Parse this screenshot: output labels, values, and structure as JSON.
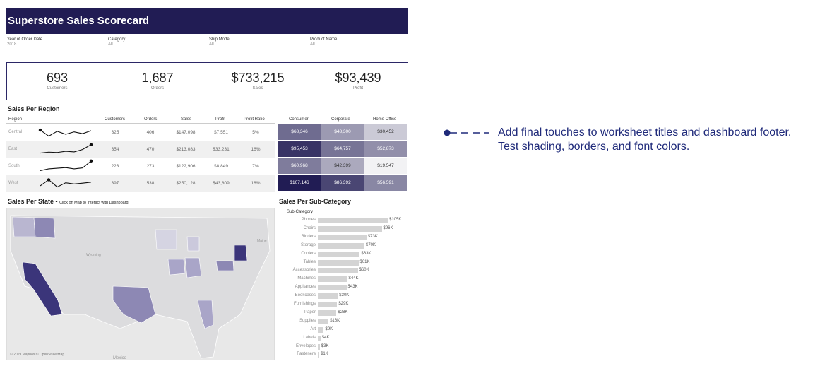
{
  "dashboard": {
    "title": "Superstore Sales Scorecard",
    "filters": [
      {
        "label": "Year of Order Date",
        "value": "2018"
      },
      {
        "label": "Category",
        "value": "All"
      },
      {
        "label": "Ship Mode",
        "value": "All"
      },
      {
        "label": "Product Name",
        "value": "All"
      }
    ],
    "kpis": [
      {
        "value": "693",
        "label": "Customers"
      },
      {
        "value": "1,687",
        "label": "Orders"
      },
      {
        "value": "$733,215",
        "label": "Sales"
      },
      {
        "value": "$93,439",
        "label": "Profit"
      }
    ],
    "region_section": {
      "title": "Sales Per Region",
      "region_header": "Region",
      "columns": [
        "Customers",
        "Orders",
        "Sales",
        "Profit",
        "Profit Ratio"
      ],
      "segment_columns": [
        "Consumer",
        "Corporate",
        "Home Office"
      ],
      "rows": [
        {
          "region": "Central",
          "customers": "325",
          "orders": "406",
          "sales": "$147,098",
          "profit": "$7,551",
          "ratio": "5%",
          "segments": [
            "$68,346",
            "$48,300",
            "$30,452"
          ],
          "segment_values": [
            68346,
            48300,
            30452
          ],
          "sparkline": [
            70,
            20,
            60,
            35,
            55,
            40,
            65
          ]
        },
        {
          "region": "East",
          "customers": "354",
          "orders": "470",
          "sales": "$213,083",
          "profit": "$33,231",
          "ratio": "16%",
          "segments": [
            "$95,453",
            "$64,757",
            "$52,873"
          ],
          "segment_values": [
            95453,
            64757,
            52873
          ],
          "sparkline": [
            20,
            28,
            25,
            35,
            30,
            50,
            90
          ]
        },
        {
          "region": "South",
          "customers": "223",
          "orders": "273",
          "sales": "$122,906",
          "profit": "$8,849",
          "ratio": "7%",
          "segments": [
            "$60,968",
            "$42,399",
            "$19,547"
          ],
          "segment_values": [
            60968,
            42399,
            19547
          ],
          "sparkline": [
            15,
            30,
            35,
            40,
            30,
            38,
            95
          ]
        },
        {
          "region": "West",
          "customers": "397",
          "orders": "538",
          "sales": "$250,128",
          "profit": "$43,809",
          "ratio": "18%",
          "segments": [
            "$107,146",
            "$86,392",
            "$56,591"
          ],
          "segment_values": [
            107146,
            86392,
            56591
          ],
          "sparkline": [
            30,
            80,
            20,
            55,
            45,
            52,
            60
          ]
        }
      ],
      "heat_colors": {
        "low": "#f2f2f4",
        "high": "#211c54"
      }
    },
    "state_section": {
      "title": "Sales Per State -",
      "subtitle": "Click on Map to Interact with Dashboard",
      "map_labels": [
        "Wyoming",
        "Maine",
        "Mexico"
      ],
      "attribution": "© 2019 Mapbox © OpenStreetMap"
    },
    "subcategory_section": {
      "title": "Sales Per Sub-Category",
      "axis_header": "Sub-Category"
    }
  },
  "chart_data": {
    "type": "bar",
    "title": "Sales Per Sub-Category",
    "categories": [
      "Phones",
      "Chairs",
      "Binders",
      "Storage",
      "Copiers",
      "Tables",
      "Accessories",
      "Machines",
      "Appliances",
      "Bookcases",
      "Furnishings",
      "Paper",
      "Supplies",
      "Art",
      "Labels",
      "Envelopes",
      "Fasteners"
    ],
    "values": [
      105,
      96,
      73,
      70,
      63,
      61,
      60,
      44,
      43,
      30,
      29,
      28,
      16,
      9,
      4,
      3,
      1
    ],
    "value_labels": [
      "$105K",
      "$96K",
      "$73K",
      "$70K",
      "$63K",
      "$61K",
      "$60K",
      "$44K",
      "$43K",
      "$30K",
      "$29K",
      "$28K",
      "$16K",
      "$9K",
      "$4K",
      "$3K",
      "$1K"
    ],
    "orientation": "horizontal",
    "bar_color": "#d4d4d4"
  },
  "annotation": {
    "text": "Add final touches to worksheet titles and dashboard footer. Test shading, borders, and font colors.",
    "color": "#1f2a7a"
  }
}
